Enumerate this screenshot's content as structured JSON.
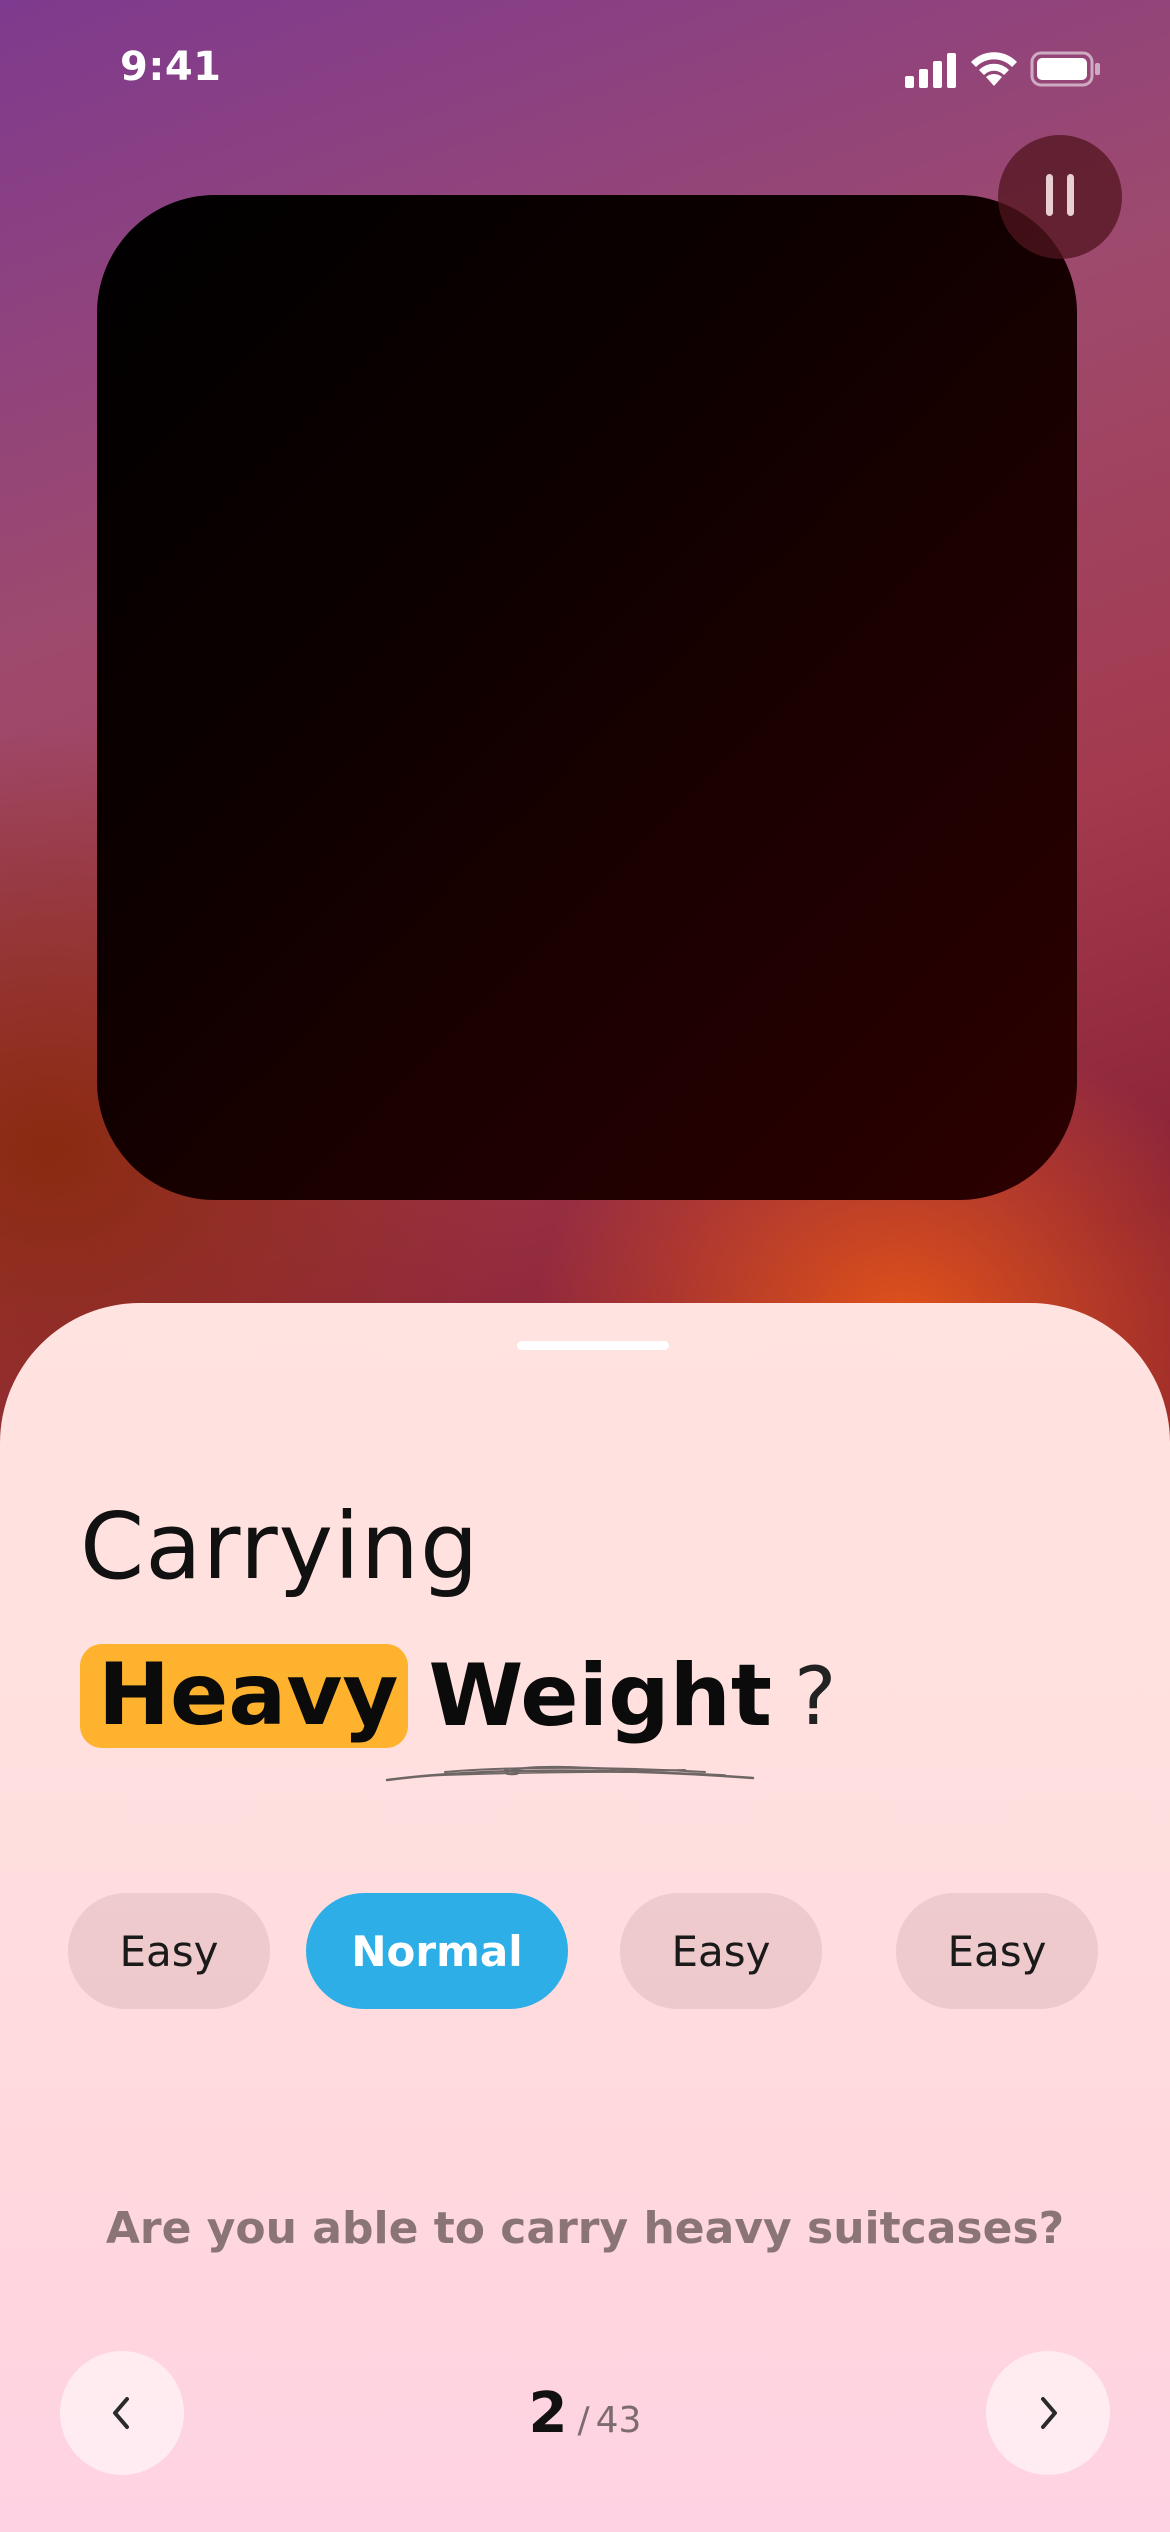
{
  "status_bar": {
    "time": "9:41",
    "icons": [
      "signal-icon",
      "wifi-icon",
      "battery-icon"
    ]
  },
  "media": {
    "pause_icon": "pause-icon"
  },
  "question": {
    "title_line1": "Carrying",
    "highlight_word": "Heavy",
    "plain_word": "Weight",
    "question_mark": "?",
    "prompt": "Are you able to carry heavy suitcases?"
  },
  "options": [
    {
      "label": "Easy",
      "selected": false
    },
    {
      "label": "Normal",
      "selected": true
    },
    {
      "label": "Easy",
      "selected": false
    },
    {
      "label": "Easy",
      "selected": false
    }
  ],
  "pager": {
    "current": "2",
    "separator": "/",
    "total": "43"
  },
  "navigation": {
    "prev_icon": "chevron-left-icon",
    "next_icon": "chevron-right-icon"
  },
  "colors": {
    "highlight": "#ffb22d",
    "selected_option": "#2eaee6"
  }
}
